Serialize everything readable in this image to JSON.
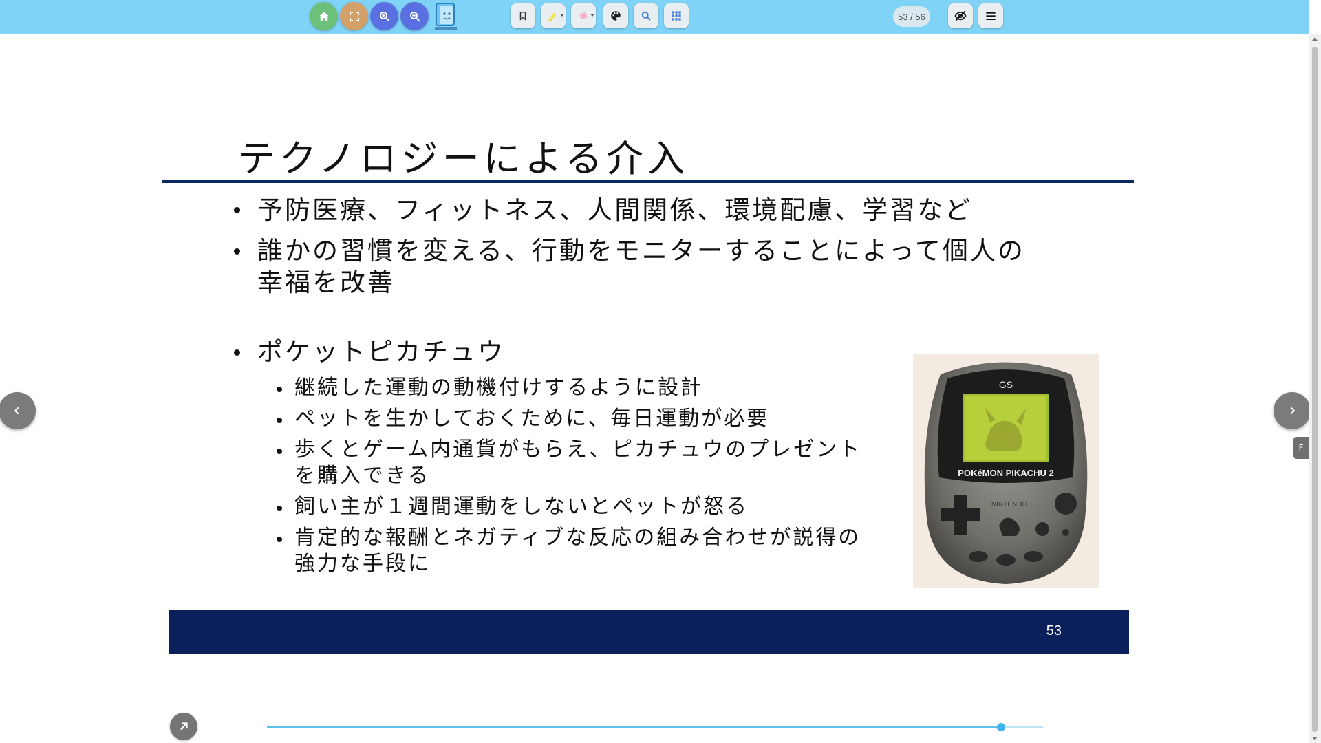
{
  "toolbar": {
    "buttons": [
      {
        "id": "home",
        "icon": "home-icon",
        "color": "#6cc07a"
      },
      {
        "id": "fullscreen",
        "icon": "fullscreen-icon",
        "color": "#d4a06a"
      },
      {
        "id": "zoom_in",
        "icon": "zoom-in-icon",
        "color": "#5a6fe0"
      },
      {
        "id": "zoom_out",
        "icon": "zoom-out-icon",
        "color": "#5a6fe0"
      },
      {
        "id": "logo",
        "icon": "app-logo-icon"
      },
      {
        "id": "bookmark",
        "icon": "bookmark-icon"
      },
      {
        "id": "highlighter",
        "icon": "highlighter-icon"
      },
      {
        "id": "eraser",
        "icon": "eraser-icon"
      },
      {
        "id": "palette",
        "icon": "palette-icon"
      },
      {
        "id": "search",
        "icon": "search-icon"
      },
      {
        "id": "grid",
        "icon": "grid-icon"
      },
      {
        "id": "hide",
        "icon": "eye-off-icon"
      },
      {
        "id": "menu",
        "icon": "menu-icon"
      }
    ],
    "page_counter": "53 / 56"
  },
  "slide": {
    "title": "テクノロジーによる介入",
    "bullets": [
      {
        "level": 1,
        "lines": [
          "予防医療、フィットネス、人間関係、環境配慮、学習など"
        ]
      },
      {
        "level": 1,
        "lines": [
          "誰かの習慣を変える、行動をモニターすることによって個人の",
          "幸福を改善"
        ]
      },
      {
        "level": 1,
        "lines": [
          "ポケットピカチュウ"
        ]
      },
      {
        "level": 2,
        "lines": [
          "継続した運動の動機付けするように設計"
        ]
      },
      {
        "level": 2,
        "lines": [
          "ペットを生かしておくために、毎日運動が必要"
        ]
      },
      {
        "level": 2,
        "lines": [
          "歩くとゲーム内通貨がもらえ、ピカチュウのプレゼント",
          "を購入できる"
        ]
      },
      {
        "level": 2,
        "lines": [
          "飼い主が１週間運動をしないとペットが怒る"
        ]
      },
      {
        "level": 2,
        "lines": [
          "肯定的な報酬とネガティブな反応の組み合わせが説得の",
          "強力な手段に"
        ]
      }
    ],
    "photo": {
      "brand": "GS",
      "label": "POKéMON PIKACHU 2",
      "maker": "NINTENDO"
    },
    "page_number": "53"
  },
  "side_tab": "F",
  "progress": {
    "current": 53,
    "total": 56,
    "fraction": 0.946
  },
  "colors": {
    "toolbar": "#7fd3f7",
    "navy": "#0b1f5b",
    "rule": "#0b2a5e",
    "progress": "#5bc3ee"
  }
}
